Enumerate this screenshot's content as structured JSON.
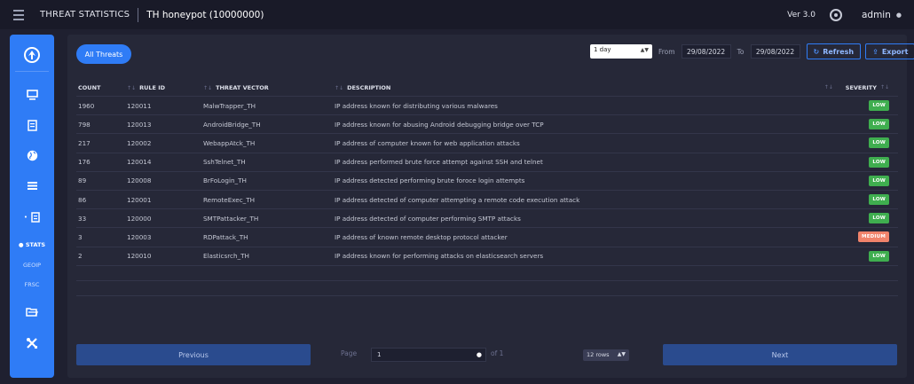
{
  "topbar": {
    "title": "THREAT STATISTICS",
    "subtitle": "TH honeypot (10000000)",
    "version": "Ver 3.0",
    "user": "admin"
  },
  "sidebar": {
    "sub_items": [
      {
        "label": "● STATS",
        "active": true
      },
      {
        "label": "GEOIP",
        "active": false
      },
      {
        "label": "FRSC",
        "active": false
      }
    ]
  },
  "controls": {
    "all_threats_label": "All Threats",
    "period": "1 day",
    "from_label": "From",
    "from_date": "29/08/2022",
    "to_label": "To",
    "to_date": "29/08/2022",
    "refresh_label": "Refresh",
    "export_label": "Export"
  },
  "table": {
    "headers": [
      "COUNT",
      "RULE ID",
      "THREAT VECTOR",
      "DESCRIPTION",
      "SEVERITY"
    ],
    "rows": [
      {
        "count": "1960",
        "rule_id": "120011",
        "vector": "MalwTrapper_TH",
        "description": "IP address known for distributing various malwares",
        "severity": "LOW"
      },
      {
        "count": "798",
        "rule_id": "120013",
        "vector": "AndroidBridge_TH",
        "description": "IP address known for abusing Android debugging bridge over TCP",
        "severity": "LOW"
      },
      {
        "count": "217",
        "rule_id": "120002",
        "vector": "WebappAtck_TH",
        "description": "IP address of computer known for web application attacks",
        "severity": "LOW"
      },
      {
        "count": "176",
        "rule_id": "120014",
        "vector": "SshTelnet_TH",
        "description": "IP address performed brute force attempt against SSH and telnet",
        "severity": "LOW"
      },
      {
        "count": "89",
        "rule_id": "120008",
        "vector": "BrFoLogin_TH",
        "description": "IP address detected performing brute foroce login attempts",
        "severity": "LOW"
      },
      {
        "count": "86",
        "rule_id": "120001",
        "vector": "RemoteExec_TH",
        "description": "IP address detected of computer attempting a remote code execution attack",
        "severity": "LOW"
      },
      {
        "count": "33",
        "rule_id": "120000",
        "vector": "SMTPattacker_TH",
        "description": "IP address detected of computer performing SMTP attacks",
        "severity": "LOW"
      },
      {
        "count": "3",
        "rule_id": "120003",
        "vector": "RDPattack_TH",
        "description": "IP address of known remote desktop protocol attacker",
        "severity": "MEDIUM"
      },
      {
        "count": "2",
        "rule_id": "120010",
        "vector": "Elasticsrch_TH",
        "description": "IP address known for performing attacks on elasticsearch servers",
        "severity": "LOW"
      }
    ],
    "severity_colors": {
      "LOW": "#3fae4f",
      "MEDIUM": "#f0836b"
    }
  },
  "pagination": {
    "previous_label": "Previous",
    "page_label": "Page",
    "page_value": "1",
    "of_label": "of 1",
    "rows_option": "12 rows",
    "next_label": "Next"
  }
}
